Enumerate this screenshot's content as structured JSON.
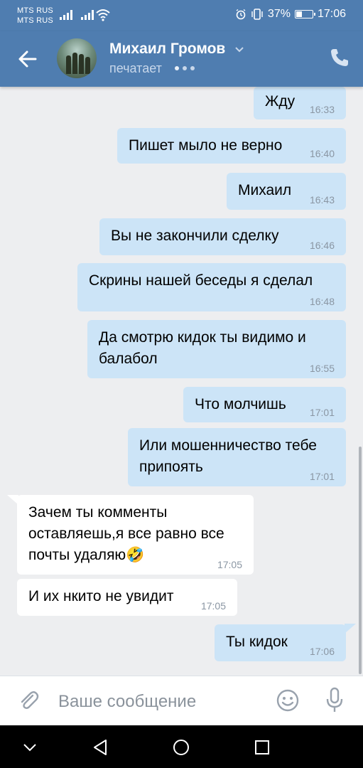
{
  "status_bar": {
    "carrier_1": "MTS RUS",
    "carrier_2": "MTS RUS",
    "battery": "37%",
    "battery_level": 0.37,
    "time": "17:06"
  },
  "header": {
    "contact_name": "Михаил Громов",
    "status": "печатает",
    "icons": [
      "back-arrow-icon",
      "chevron-down-icon",
      "phone-icon"
    ]
  },
  "messages": [
    {
      "dir": "out",
      "text": "Жду",
      "time": "16:33"
    },
    {
      "dir": "out",
      "text": "Пишет мыло не верно",
      "time": "16:40"
    },
    {
      "dir": "out",
      "text": "Михаил",
      "time": "16:43"
    },
    {
      "dir": "out",
      "text": "Вы не закончили сделку",
      "time": "16:46"
    },
    {
      "dir": "out",
      "text": "Скрины нашей беседы я сделал",
      "time": "16:48"
    },
    {
      "dir": "out",
      "line1": "Да смотрю кидок ты видимо и",
      "line2": "балабол",
      "time": "16:55"
    },
    {
      "dir": "out",
      "text": "Что молчишь",
      "time": "17:01"
    },
    {
      "dir": "out",
      "line1": "Или мошенничество тебе",
      "line2": "припоять",
      "time": "17:01"
    },
    {
      "dir": "in",
      "line1": "Зачем ты комменты",
      "line2": "оставляешь,я все равно все",
      "line3": "почты удаляю",
      "emoji": "🤣",
      "time": "17:05"
    },
    {
      "dir": "in",
      "text": "И их нкито не увидит",
      "time": "17:05"
    },
    {
      "dir": "out",
      "text": "Ты кидок",
      "time": "17:06"
    }
  ],
  "compose": {
    "placeholder": "Ваше сообщение",
    "icons": [
      "attach-icon",
      "emoji-icon",
      "microphone-icon"
    ]
  },
  "colors": {
    "header": "#4f7db0",
    "outgoing_bubble": "#cce4f7",
    "incoming_bubble": "#ffffff",
    "background": "#edeef0"
  }
}
